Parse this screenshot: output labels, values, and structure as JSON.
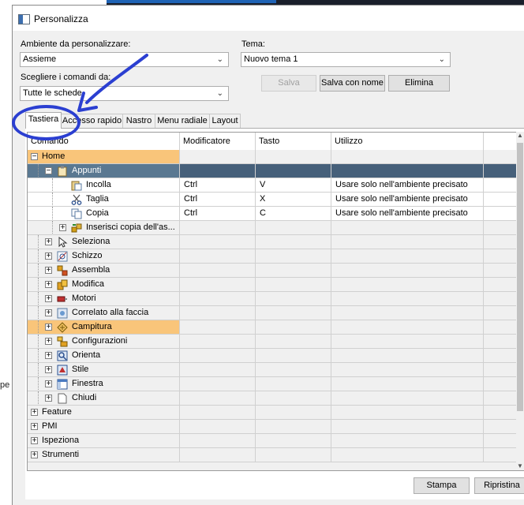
{
  "background": {
    "cut_text": "pe"
  },
  "window": {
    "title": "Personalizza"
  },
  "form": {
    "env_label": "Ambiente da personalizzare:",
    "env_value": "Assieme",
    "commands_label": "Scegliere i comandi da:",
    "commands_value": "Tutte le schede",
    "theme_label": "Tema:",
    "theme_value": "Nuovo tema 1",
    "save_label": "Salva",
    "save_as_label": "Salva con nome",
    "delete_label": "Elimina"
  },
  "tabs": [
    {
      "label": "Tastiera",
      "active": true
    },
    {
      "label": "Accesso rapido",
      "active": false
    },
    {
      "label": "Nastro",
      "active": false
    },
    {
      "label": "Menu radiale",
      "active": false
    },
    {
      "label": "Layout",
      "active": false
    }
  ],
  "grid": {
    "columns": [
      "Comando",
      "Modificatore",
      "Tasto",
      "Utilizzo"
    ],
    "rows": [
      {
        "label": "Home",
        "level": 0,
        "expander": "−",
        "icon": "",
        "mod": "",
        "key": "",
        "usage": "",
        "style": "orange"
      },
      {
        "label": "Appunti",
        "level": 1,
        "expander": "−",
        "icon": "clipboard-icon",
        "mod": "",
        "key": "",
        "usage": "",
        "style": "selected"
      },
      {
        "label": "Incolla",
        "level": 2,
        "expander": "",
        "icon": "paste-icon",
        "mod": "Ctrl",
        "key": "V",
        "usage": "Usare solo nell'ambiente precisato",
        "style": "white"
      },
      {
        "label": "Taglia",
        "level": 2,
        "expander": "",
        "icon": "scissors-icon",
        "mod": "Ctrl",
        "key": "X",
        "usage": "Usare solo nell'ambiente precisato",
        "style": "white"
      },
      {
        "label": "Copia",
        "level": 2,
        "expander": "",
        "icon": "copy-icon",
        "mod": "Ctrl",
        "key": "C",
        "usage": "Usare solo nell'ambiente precisato",
        "style": "white"
      },
      {
        "label": "Inserisci copia dell'as...",
        "level": 2,
        "expander": "+",
        "icon": "insert-copy-icon",
        "mod": "",
        "key": "",
        "usage": "",
        "style": "gray"
      },
      {
        "label": "Seleziona",
        "level": 1,
        "expander": "+",
        "icon": "cursor-icon",
        "mod": "",
        "key": "",
        "usage": "",
        "style": "gray"
      },
      {
        "label": "Schizzo",
        "level": 1,
        "expander": "+",
        "icon": "sketch-icon",
        "mod": "",
        "key": "",
        "usage": "",
        "style": "gray"
      },
      {
        "label": "Assembla",
        "level": 1,
        "expander": "+",
        "icon": "assembly-icon",
        "mod": "",
        "key": "",
        "usage": "",
        "style": "gray"
      },
      {
        "label": "Modifica",
        "level": 1,
        "expander": "+",
        "icon": "modify-icon",
        "mod": "",
        "key": "",
        "usage": "",
        "style": "gray"
      },
      {
        "label": "Motori",
        "level": 1,
        "expander": "+",
        "icon": "motor-icon",
        "mod": "",
        "key": "",
        "usage": "",
        "style": "gray"
      },
      {
        "label": "Correlato alla faccia",
        "level": 1,
        "expander": "+",
        "icon": "face-related-icon",
        "mod": "",
        "key": "",
        "usage": "",
        "style": "gray"
      },
      {
        "label": "Campitura",
        "level": 1,
        "expander": "+",
        "icon": "hatch-icon",
        "mod": "",
        "key": "",
        "usage": "",
        "style": "orange"
      },
      {
        "label": "Configurazioni",
        "level": 1,
        "expander": "+",
        "icon": "configurations-icon",
        "mod": "",
        "key": "",
        "usage": "",
        "style": "gray"
      },
      {
        "label": "Orienta",
        "level": 1,
        "expander": "+",
        "icon": "orient-icon",
        "mod": "",
        "key": "",
        "usage": "",
        "style": "gray"
      },
      {
        "label": "Stile",
        "level": 1,
        "expander": "+",
        "icon": "style-icon",
        "mod": "",
        "key": "",
        "usage": "",
        "style": "gray"
      },
      {
        "label": "Finestra",
        "level": 1,
        "expander": "+",
        "icon": "window-icon",
        "mod": "",
        "key": "",
        "usage": "",
        "style": "gray"
      },
      {
        "label": "Chiudi",
        "level": 1,
        "expander": "+",
        "icon": "close-doc-icon",
        "mod": "",
        "key": "",
        "usage": "",
        "style": "gray"
      },
      {
        "label": "Feature",
        "level": 0,
        "expander": "+",
        "icon": "",
        "mod": "",
        "key": "",
        "usage": "",
        "style": "gray"
      },
      {
        "label": "PMI",
        "level": 0,
        "expander": "+",
        "icon": "",
        "mod": "",
        "key": "",
        "usage": "",
        "style": "gray"
      },
      {
        "label": "Ispeziona",
        "level": 0,
        "expander": "+",
        "icon": "",
        "mod": "",
        "key": "",
        "usage": "",
        "style": "gray"
      },
      {
        "label": "Strumenti",
        "level": 0,
        "expander": "+",
        "icon": "",
        "mod": "",
        "key": "",
        "usage": "",
        "style": "gray"
      }
    ]
  },
  "footer": {
    "print_label": "Stampa",
    "reset_label": "Ripristina"
  },
  "annotation": {
    "color": "#2b3fd1"
  }
}
